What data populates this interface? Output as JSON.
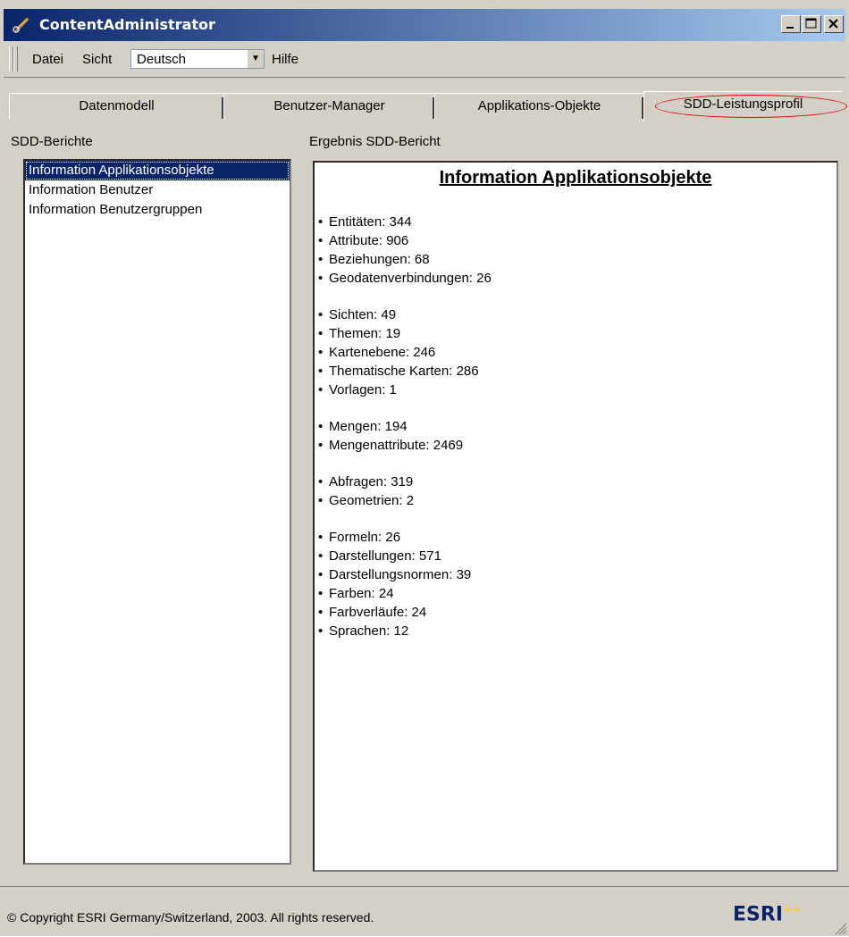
{
  "window": {
    "title": "ContentAdministrator",
    "caption_buttons": [
      "_",
      "□",
      "X"
    ]
  },
  "menu": {
    "datei": "Datei",
    "sicht": "Sicht",
    "language_select": "Deutsch",
    "hilfe": "Hilfe"
  },
  "tabs": [
    {
      "label": "Datenmodell"
    },
    {
      "label": "Benutzer-Manager"
    },
    {
      "label": "Applikations-Objekte"
    },
    {
      "label": "SDD-Leistungsprofil",
      "active": true
    }
  ],
  "left_panel": {
    "label": "SDD-Berichte",
    "items": [
      "Information Applikationsobjekte",
      "Information Benutzer",
      "Information Benutzergruppen"
    ]
  },
  "right_panel": {
    "label": "Ergebnis SDD-Bericht",
    "report_title": "Information Applikationsobjekte",
    "groups": [
      [
        "Entitäten: 344",
        "Attribute: 906",
        "Beziehungen: 68",
        "Geodatenverbindungen: 26"
      ],
      [
        "Sichten: 49",
        "Themen: 19",
        "Kartenebene: 246",
        "Thematische Karten: 286",
        "Vorlagen: 1"
      ],
      [
        "Mengen: 194",
        "Mengenattribute: 2469"
      ],
      [
        "Abfragen: 319",
        "Geometrien: 2"
      ],
      [
        "Formeln: 26",
        "Darstellungen: 571",
        "Darstellungsnormen: 39",
        "Farben: 24",
        "Farbverläufe: 24",
        "Sprachen: 12"
      ]
    ]
  },
  "footer": {
    "copyright": "© Copyright ESRI Germany/Switzerland, 2003. All rights reserved.",
    "logo": "ESRI",
    "logo_sup": "++"
  },
  "colors": {
    "title_bar": "#0a246a",
    "selection": "#0a246a",
    "highlight_ring": "#e00000",
    "window_face": "#d4d0c8"
  }
}
